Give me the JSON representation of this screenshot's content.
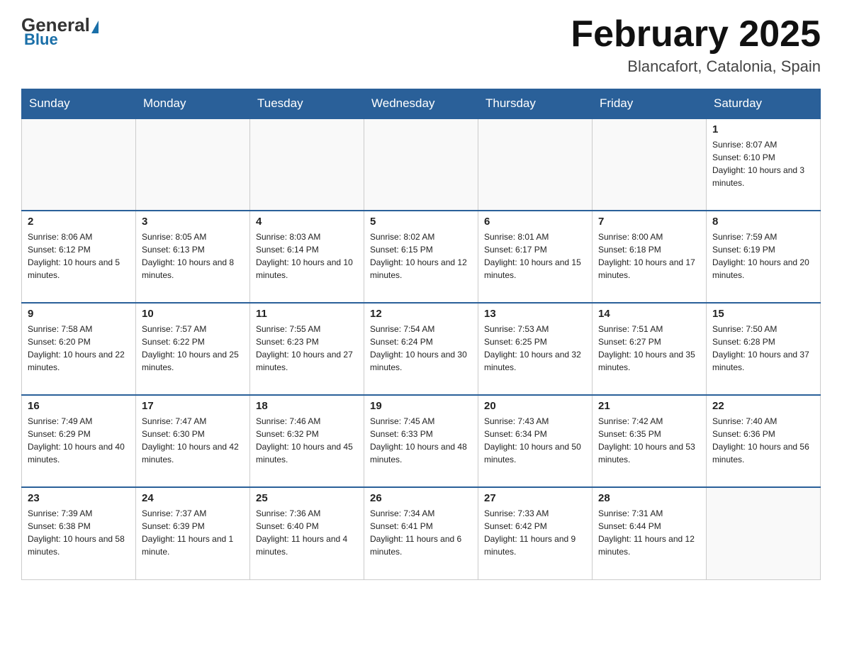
{
  "logo": {
    "general": "General",
    "blue": "Blue"
  },
  "header": {
    "title": "February 2025",
    "subtitle": "Blancafort, Catalonia, Spain"
  },
  "weekdays": [
    "Sunday",
    "Monday",
    "Tuesday",
    "Wednesday",
    "Thursday",
    "Friday",
    "Saturday"
  ],
  "weeks": [
    [
      {
        "day": "",
        "info": ""
      },
      {
        "day": "",
        "info": ""
      },
      {
        "day": "",
        "info": ""
      },
      {
        "day": "",
        "info": ""
      },
      {
        "day": "",
        "info": ""
      },
      {
        "day": "",
        "info": ""
      },
      {
        "day": "1",
        "info": "Sunrise: 8:07 AM\nSunset: 6:10 PM\nDaylight: 10 hours and 3 minutes."
      }
    ],
    [
      {
        "day": "2",
        "info": "Sunrise: 8:06 AM\nSunset: 6:12 PM\nDaylight: 10 hours and 5 minutes."
      },
      {
        "day": "3",
        "info": "Sunrise: 8:05 AM\nSunset: 6:13 PM\nDaylight: 10 hours and 8 minutes."
      },
      {
        "day": "4",
        "info": "Sunrise: 8:03 AM\nSunset: 6:14 PM\nDaylight: 10 hours and 10 minutes."
      },
      {
        "day": "5",
        "info": "Sunrise: 8:02 AM\nSunset: 6:15 PM\nDaylight: 10 hours and 12 minutes."
      },
      {
        "day": "6",
        "info": "Sunrise: 8:01 AM\nSunset: 6:17 PM\nDaylight: 10 hours and 15 minutes."
      },
      {
        "day": "7",
        "info": "Sunrise: 8:00 AM\nSunset: 6:18 PM\nDaylight: 10 hours and 17 minutes."
      },
      {
        "day": "8",
        "info": "Sunrise: 7:59 AM\nSunset: 6:19 PM\nDaylight: 10 hours and 20 minutes."
      }
    ],
    [
      {
        "day": "9",
        "info": "Sunrise: 7:58 AM\nSunset: 6:20 PM\nDaylight: 10 hours and 22 minutes."
      },
      {
        "day": "10",
        "info": "Sunrise: 7:57 AM\nSunset: 6:22 PM\nDaylight: 10 hours and 25 minutes."
      },
      {
        "day": "11",
        "info": "Sunrise: 7:55 AM\nSunset: 6:23 PM\nDaylight: 10 hours and 27 minutes."
      },
      {
        "day": "12",
        "info": "Sunrise: 7:54 AM\nSunset: 6:24 PM\nDaylight: 10 hours and 30 minutes."
      },
      {
        "day": "13",
        "info": "Sunrise: 7:53 AM\nSunset: 6:25 PM\nDaylight: 10 hours and 32 minutes."
      },
      {
        "day": "14",
        "info": "Sunrise: 7:51 AM\nSunset: 6:27 PM\nDaylight: 10 hours and 35 minutes."
      },
      {
        "day": "15",
        "info": "Sunrise: 7:50 AM\nSunset: 6:28 PM\nDaylight: 10 hours and 37 minutes."
      }
    ],
    [
      {
        "day": "16",
        "info": "Sunrise: 7:49 AM\nSunset: 6:29 PM\nDaylight: 10 hours and 40 minutes."
      },
      {
        "day": "17",
        "info": "Sunrise: 7:47 AM\nSunset: 6:30 PM\nDaylight: 10 hours and 42 minutes."
      },
      {
        "day": "18",
        "info": "Sunrise: 7:46 AM\nSunset: 6:32 PM\nDaylight: 10 hours and 45 minutes."
      },
      {
        "day": "19",
        "info": "Sunrise: 7:45 AM\nSunset: 6:33 PM\nDaylight: 10 hours and 48 minutes."
      },
      {
        "day": "20",
        "info": "Sunrise: 7:43 AM\nSunset: 6:34 PM\nDaylight: 10 hours and 50 minutes."
      },
      {
        "day": "21",
        "info": "Sunrise: 7:42 AM\nSunset: 6:35 PM\nDaylight: 10 hours and 53 minutes."
      },
      {
        "day": "22",
        "info": "Sunrise: 7:40 AM\nSunset: 6:36 PM\nDaylight: 10 hours and 56 minutes."
      }
    ],
    [
      {
        "day": "23",
        "info": "Sunrise: 7:39 AM\nSunset: 6:38 PM\nDaylight: 10 hours and 58 minutes."
      },
      {
        "day": "24",
        "info": "Sunrise: 7:37 AM\nSunset: 6:39 PM\nDaylight: 11 hours and 1 minute."
      },
      {
        "day": "25",
        "info": "Sunrise: 7:36 AM\nSunset: 6:40 PM\nDaylight: 11 hours and 4 minutes."
      },
      {
        "day": "26",
        "info": "Sunrise: 7:34 AM\nSunset: 6:41 PM\nDaylight: 11 hours and 6 minutes."
      },
      {
        "day": "27",
        "info": "Sunrise: 7:33 AM\nSunset: 6:42 PM\nDaylight: 11 hours and 9 minutes."
      },
      {
        "day": "28",
        "info": "Sunrise: 7:31 AM\nSunset: 6:44 PM\nDaylight: 11 hours and 12 minutes."
      },
      {
        "day": "",
        "info": ""
      }
    ]
  ]
}
